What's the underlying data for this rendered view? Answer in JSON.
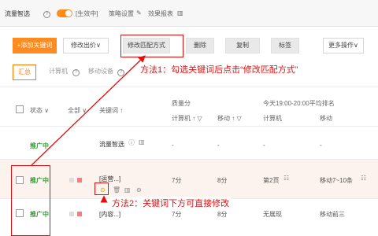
{
  "topbar": {
    "smart_label": "流量智选",
    "status": "[生效中]",
    "strategy": "策略设置",
    "report": "效果报表"
  },
  "toolbar": {
    "add_keyword": "+添加关键词",
    "modify_bid": "修改出价∨",
    "modify_match": "修改匹配方式",
    "delete": "删除",
    "copy": "复制",
    "tag": "标签",
    "more": "更多操作∨"
  },
  "tabs": {
    "summary": "汇总",
    "computer": "计算机",
    "mobile": "移动设备",
    "trend": "趋势图表"
  },
  "table": {
    "col_status": "状态 ∨",
    "col_all": "全部 ∨",
    "col_keyword": "关键词 ↑",
    "col_quality": "质量分",
    "col_quality_pc": "计算机 ↑ ▽",
    "col_quality_mobile": "移动 ↑ ▽",
    "col_rank": "今天19:00-20:00平均排名",
    "col_rank_pc": "计算机",
    "col_rank_mobile": "移动",
    "rows": [
      {
        "status": "推广中",
        "keyword": "流量智选",
        "q_pc": "-",
        "q_mobile": "-",
        "r_pc": "-",
        "r_mobile": "-"
      },
      {
        "status": "推广中",
        "keyword": "[运营...]",
        "q_pc": "7分",
        "q_mobile": "8分",
        "r_pc": "第2页",
        "r_mobile": "移动7~10条"
      },
      {
        "status": "推广中",
        "keyword": "[内容...]",
        "q_pc": "7分",
        "q_mobile": "8分",
        "r_pc": "无展现",
        "r_mobile": "移动前三"
      }
    ]
  },
  "annotations": {
    "method1": "方法1：勾选关键词后点击“修改匹配方式”",
    "method2": "方法2：关键词下方可直接修改"
  },
  "colors": {
    "accent": "#ff8a1f",
    "annotation": "#e01010",
    "active_status": "#2e9e2e"
  }
}
